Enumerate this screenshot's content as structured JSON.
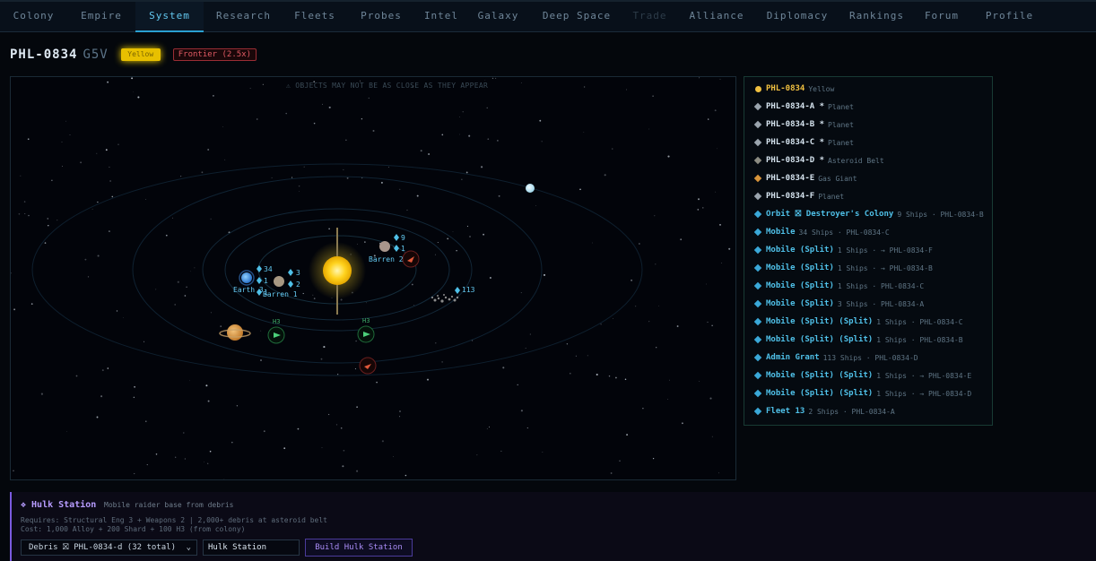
{
  "nav": {
    "tabs": [
      {
        "label": "Colony",
        "state": "normal"
      },
      {
        "label": "Empire",
        "state": "normal"
      },
      {
        "label": "System",
        "state": "active"
      },
      {
        "label": "Research",
        "state": "normal"
      },
      {
        "label": "Fleets",
        "state": "normal"
      },
      {
        "label": "Probes",
        "state": "normal"
      },
      {
        "label": "Intel",
        "state": "normal"
      },
      {
        "label": "Galaxy",
        "state": "normal"
      },
      {
        "label": "Deep Space",
        "state": "normal"
      },
      {
        "label": "Trade",
        "state": "disabled"
      },
      {
        "label": "Alliance",
        "state": "normal"
      },
      {
        "label": "Diplomacy",
        "state": "normal"
      },
      {
        "label": "Rankings",
        "state": "normal"
      },
      {
        "label": "Forum",
        "state": "normal"
      },
      {
        "label": "Profile",
        "state": "normal"
      }
    ]
  },
  "header": {
    "system_name": "PHL-0834",
    "star_class": "G5V",
    "star_badge": "Yellow",
    "frontier_badge": "Frontier (2.5x)"
  },
  "map": {
    "warning": "⚠ OBJECTS MAY NOT BE AS CLOSE AS THEY APPEAR",
    "labels": {
      "earth": "Earth 3",
      "barren1": "Barren 1",
      "barren2": "Barren 2",
      "ships_34": "34",
      "ships_1a": "1",
      "ships_1b": "1",
      "ships_3a": "3",
      "ships_2": "2",
      "ships_9": "9",
      "ships_1c": "1",
      "ships_113": "113",
      "h3a": "H3",
      "h3b": "H3"
    }
  },
  "objects": [
    {
      "name": "PHL-0834",
      "extra": "Yellow",
      "marker": "dot",
      "color": "#f0c040",
      "kind": "star"
    },
    {
      "name": "PHL-0834-A *",
      "extra": "Planet",
      "marker": "dia",
      "color": "#9aa4ad",
      "kind": "body"
    },
    {
      "name": "PHL-0834-B *",
      "extra": "Planet",
      "marker": "dia",
      "color": "#9aa4ad",
      "kind": "body"
    },
    {
      "name": "PHL-0834-C *",
      "extra": "Planet",
      "marker": "dia",
      "color": "#9aa4ad",
      "kind": "body"
    },
    {
      "name": "PHL-0834-D *",
      "extra": "Asteroid Belt",
      "marker": "dia",
      "color": "#8c8c82",
      "kind": "body"
    },
    {
      "name": "PHL-0834-E",
      "extra": "Gas Giant",
      "marker": "dia",
      "color": "#d8943a",
      "kind": "body"
    },
    {
      "name": "PHL-0834-F",
      "extra": "Planet",
      "marker": "dia",
      "color": "#9aa4ad",
      "kind": "body"
    },
    {
      "name": "Orbit ⛝ Destroyer's Colony",
      "extra": "9 Ships · PHL-0834-B",
      "marker": "dia",
      "color": "#3aa8d8",
      "kind": "fleet"
    },
    {
      "name": "Mobile",
      "extra": "34 Ships · PHL-0834-C",
      "marker": "dia",
      "color": "#3aa8d8",
      "kind": "fleet"
    },
    {
      "name": "Mobile (Split)",
      "extra": "1 Ships · → PHL-0834-F",
      "marker": "dia",
      "color": "#3aa8d8",
      "kind": "fleet"
    },
    {
      "name": "Mobile (Split)",
      "extra": "1 Ships · → PHL-0834-B",
      "marker": "dia",
      "color": "#3aa8d8",
      "kind": "fleet"
    },
    {
      "name": "Mobile (Split)",
      "extra": "1 Ships · PHL-0834-C",
      "marker": "dia",
      "color": "#3aa8d8",
      "kind": "fleet"
    },
    {
      "name": "Mobile (Split)",
      "extra": "3 Ships · PHL-0834-A",
      "marker": "dia",
      "color": "#3aa8d8",
      "kind": "fleet"
    },
    {
      "name": "Mobile (Split) (Split)",
      "extra": "1 Ships · PHL-0834-C",
      "marker": "dia",
      "color": "#3aa8d8",
      "kind": "fleet"
    },
    {
      "name": "Mobile (Split) (Split)",
      "extra": "1 Ships · PHL-0834-B",
      "marker": "dia",
      "color": "#3aa8d8",
      "kind": "fleet"
    },
    {
      "name": "Admin Grant",
      "extra": "113 Ships · PHL-0834-D",
      "marker": "dia",
      "color": "#3aa8d8",
      "kind": "fleet"
    },
    {
      "name": "Mobile (Split) (Split)",
      "extra": "1 Ships · → PHL-0834-E",
      "marker": "dia",
      "color": "#3aa8d8",
      "kind": "fleet"
    },
    {
      "name": "Mobile (Split) (Split)",
      "extra": "1 Ships · → PHL-0834-D",
      "marker": "dia",
      "color": "#3aa8d8",
      "kind": "fleet"
    },
    {
      "name": "Fleet 13",
      "extra": "2 Ships · PHL-0834-A",
      "marker": "dia",
      "color": "#3aa8d8",
      "kind": "fleet"
    }
  ],
  "hulk": {
    "title": "❖ Hulk Station",
    "subtitle": "Mobile raider base from debris",
    "requires": "Requires: Structural Eng 3 + Weapons 2 | 2,000+ debris at asteroid belt",
    "cost": "Cost: 1,000 Alloy + 200 Shard + 100 H3 (from colony)",
    "debris_selected": "Debris ⛝ PHL-0834-d (32 total)",
    "name_value": "Hulk Station",
    "build_label": "Build Hulk Station"
  }
}
